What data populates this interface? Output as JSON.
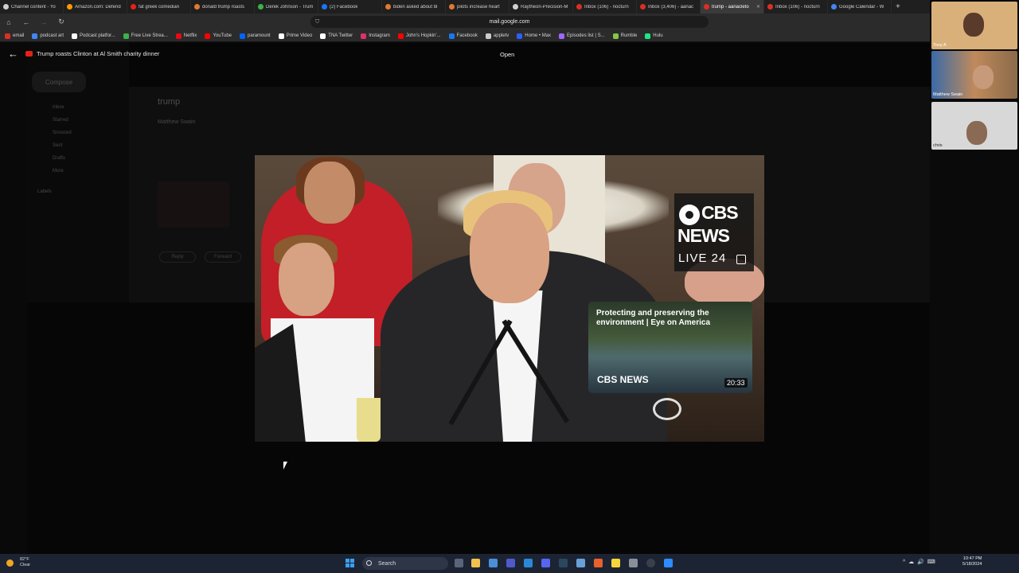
{
  "browser": {
    "tabs": [
      {
        "title": "Channel content - Yo",
        "color": "#cfcfcf"
      },
      {
        "title": "Amazon.com: Defend",
        "color": "#ff9900"
      },
      {
        "title": "fat greek comedian",
        "color": "#e62117"
      },
      {
        "title": "donald trump roasts",
        "color": "#e07a2f"
      },
      {
        "title": "Derek Johnson - Trum",
        "color": "#3bb24b"
      },
      {
        "title": "(2) Facebook",
        "color": "#1877f2"
      },
      {
        "title": "biden asked about bl",
        "color": "#e07a2f"
      },
      {
        "title": "pilots increase heart",
        "color": "#e07a2f"
      },
      {
        "title": "Raytheon-Precision-M",
        "color": "#cfcfcf"
      },
      {
        "title": "Inbox (106) - nocturn",
        "color": "#d93025"
      },
      {
        "title": "Inbox (3,406) - aanac",
        "color": "#d93025"
      },
      {
        "title": "trump - aanacleto",
        "color": "#d93025",
        "active": true
      },
      {
        "title": "Inbox (106) - nocturn",
        "color": "#d93025"
      },
      {
        "title": "Google Calendar - W",
        "color": "#4285f4"
      }
    ],
    "url": "mail.google.com",
    "bookmarks": [
      {
        "label": "email",
        "color": "#d93025"
      },
      {
        "label": "podcast art",
        "color": "#4285f4"
      },
      {
        "label": "Podcast platfor...",
        "color": "#ffffff"
      },
      {
        "label": "Free Live Strea...",
        "color": "#3bb24b"
      },
      {
        "label": "Netflix",
        "color": "#e50914"
      },
      {
        "label": "YouTube",
        "color": "#ff0000"
      },
      {
        "label": "paramount",
        "color": "#0064ff"
      },
      {
        "label": "Prime Video",
        "color": "#ffffff"
      },
      {
        "label": "TNA Twitter",
        "color": "#ffffff"
      },
      {
        "label": "Instagram",
        "color": "#e1306c"
      },
      {
        "label": "John's Hopkin'...",
        "color": "#ff0000"
      },
      {
        "label": "Facebook",
        "color": "#1877f2"
      },
      {
        "label": "appletv",
        "color": "#cccccc"
      },
      {
        "label": "Home • Max",
        "color": "#2c5fff"
      },
      {
        "label": "Episodes list | S...",
        "color": "#a066ff"
      },
      {
        "label": "Rumble",
        "color": "#85c742"
      },
      {
        "label": "Hulu",
        "color": "#1ce783"
      }
    ]
  },
  "gmail": {
    "compose": "Compose",
    "nav": [
      "Inbox",
      "Starred",
      "Snoozed",
      "Sent",
      "Drafts",
      "More"
    ],
    "labels_heading": "Labels",
    "subject": "trump",
    "sender": "Matthew Swain",
    "reply": "Reply",
    "forward": "Forward"
  },
  "overlay": {
    "video_title": "Trump roasts Clinton at Al Smith charity dinner",
    "open_label": "Open"
  },
  "video": {
    "channel_brand_line1": "CBS",
    "channel_brand_line2": "NEWS",
    "channel_brand_line3": "LIVE 24",
    "card_title": "Protecting and preserving the environment | Eye on America",
    "card_logo": "CBS NEWS",
    "card_duration": "20:33"
  },
  "participants": [
    {
      "name": "Tony A"
    },
    {
      "name": "Matthew Swain"
    },
    {
      "name": "chris"
    }
  ],
  "taskbar": {
    "temperature": "82°F",
    "condition": "Clear",
    "search_placeholder": "Search",
    "time": "10:47 PM",
    "date": "5/18/2024"
  }
}
